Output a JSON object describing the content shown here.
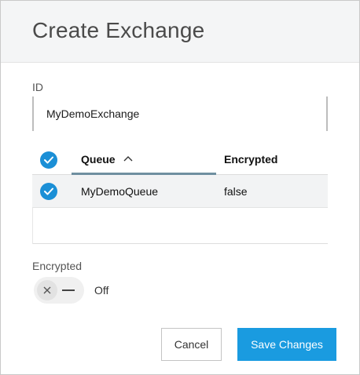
{
  "dialog": {
    "title": "Create Exchange"
  },
  "form": {
    "id_label": "ID",
    "id_value": "MyDemoExchange"
  },
  "table": {
    "columns": [
      "Queue",
      "Encrypted"
    ],
    "sort": "ascending",
    "rows": [
      {
        "selected": true,
        "queue": "MyDemoQueue",
        "encrypted": "false"
      }
    ]
  },
  "encrypted": {
    "label": "Encrypted",
    "state": "Off"
  },
  "buttons": {
    "cancel": "Cancel",
    "save": "Save Changes"
  },
  "icons": {
    "select_all": "check-circle-icon",
    "row_select": "check-circle-icon",
    "sort": "chevron-up-icon",
    "toggle_off": "x-icon"
  },
  "colors": {
    "accent": "#1a9be0",
    "checkbox": "#1b8fd6",
    "sort_underline": "#6f8fa0"
  }
}
